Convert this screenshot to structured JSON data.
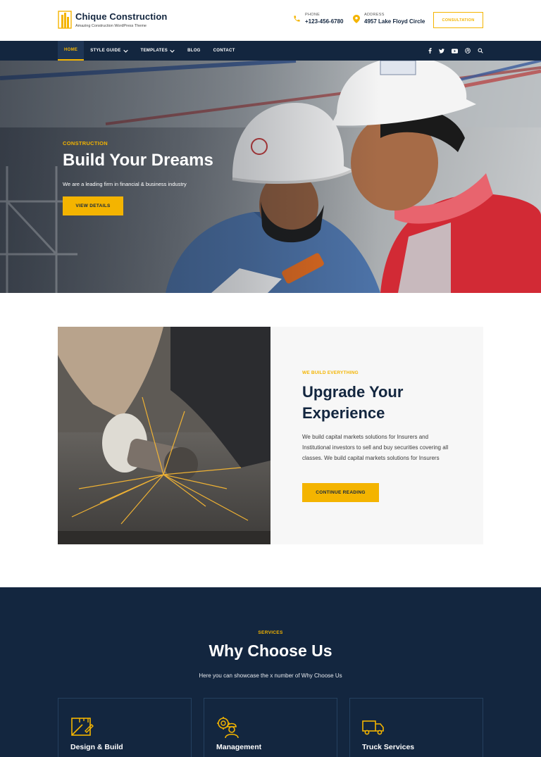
{
  "brand": {
    "name": "Chique Construction",
    "tagline": "Amazing Construction WordPress Theme",
    "accent": "#f4b400",
    "navy": "#13263f"
  },
  "header": {
    "phone": {
      "label": "PHONE",
      "value": "+123-456-6780",
      "icon": "phone-icon"
    },
    "address": {
      "label": "ADDRESS",
      "value": "4957 Lake Floyd Circle",
      "icon": "map-pin-icon"
    },
    "consult_label": "CONSULTATION"
  },
  "nav": {
    "items": [
      {
        "label": "HOME",
        "active": true
      },
      {
        "label": "STYLE GUIDE",
        "dropdown": true
      },
      {
        "label": "TEMPLATES",
        "dropdown": true
      },
      {
        "label": "BLOG"
      },
      {
        "label": "CONTACT"
      }
    ],
    "social_icons": [
      "facebook-icon",
      "twitter-icon",
      "youtube-icon",
      "dribbble-icon",
      "search-icon"
    ]
  },
  "hero": {
    "kicker": "CONSTRUCTION",
    "title": "Build Your Dreams",
    "subtitle": "We are a leading firm in financial & business industry",
    "button": "VIEW DETAILS"
  },
  "about": {
    "kicker": "WE BUILD EVERYTHING",
    "title": "Upgrade Your Experience",
    "text": "We build capital markets solutions for Insurers and Institutional investors to sell and buy securities covering all classes. We build capital markets solutions for Insurers",
    "button": "CONTINUE READING"
  },
  "services": {
    "kicker": "SERVICES",
    "title": "Why Choose Us",
    "subtitle": "Here you can showcase the x number of Why Choose Us",
    "items": [
      {
        "name": "Design & Build",
        "icon": "design-build-icon"
      },
      {
        "name": "Management",
        "icon": "management-icon"
      },
      {
        "name": "Truck Services",
        "icon": "truck-icon"
      }
    ]
  }
}
